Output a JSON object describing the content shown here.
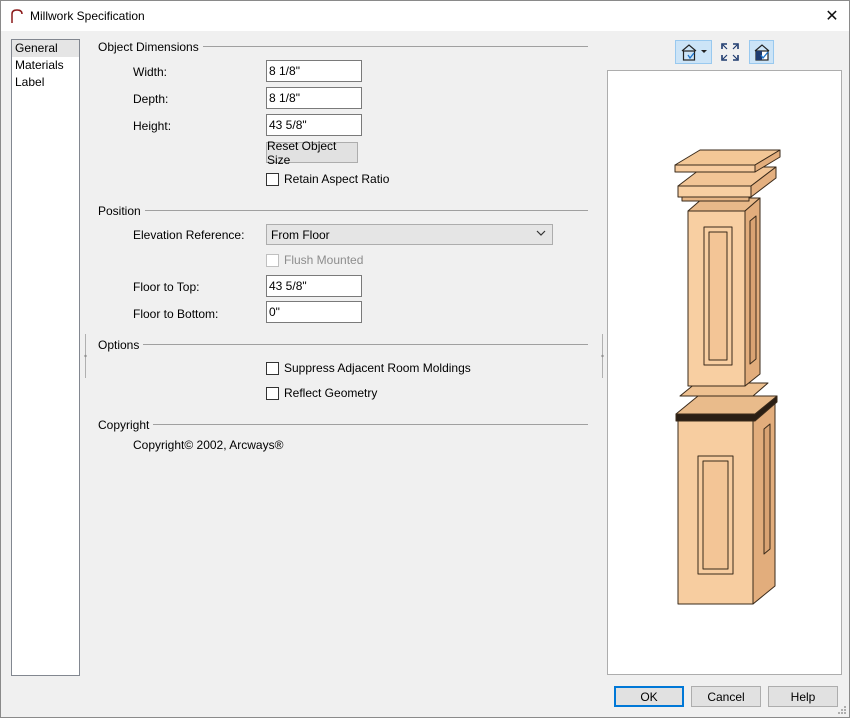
{
  "window": {
    "title": "Millwork Specification",
    "close_glyph": "✕"
  },
  "nav": {
    "items": [
      {
        "label": "General",
        "selected": true
      },
      {
        "label": "Materials",
        "selected": false
      },
      {
        "label": "Label",
        "selected": false
      }
    ]
  },
  "dimensions": {
    "group_title": "Object Dimensions",
    "width_label": "Width:",
    "width_value": "8 1/8\"",
    "depth_label": "Depth:",
    "depth_value": "8 1/8\"",
    "height_label": "Height:",
    "height_value": "43 5/8\"",
    "reset_label": "Reset Object Size",
    "retain_label": "Retain Aspect Ratio",
    "retain_checked": false
  },
  "position": {
    "group_title": "Position",
    "elevation_label": "Elevation Reference:",
    "elevation_value": "From Floor",
    "flush_label": "Flush Mounted",
    "flush_checked": false,
    "flush_enabled": false,
    "floor_top_label": "Floor to Top:",
    "floor_top_value": "43 5/8\"",
    "floor_bottom_label": "Floor to Bottom:",
    "floor_bottom_value": "0\""
  },
  "options": {
    "group_title": "Options",
    "suppress_label": "Suppress Adjacent Room Moldings",
    "suppress_checked": false,
    "reflect_label": "Reflect Geometry",
    "reflect_checked": false
  },
  "copyright": {
    "group_title": "Copyright",
    "text": "Copyright© 2002, Arcways®"
  },
  "preview_toolbar": {
    "icons": [
      "camera-view-icon",
      "fit-to-window-icon",
      "show-materials-icon"
    ]
  },
  "buttons": {
    "ok": "OK",
    "cancel": "Cancel",
    "help": "Help"
  },
  "colors": {
    "accent": "#0078d7",
    "pillar_fill": "#f5c99a",
    "pillar_edge": "#3a2a1a"
  }
}
